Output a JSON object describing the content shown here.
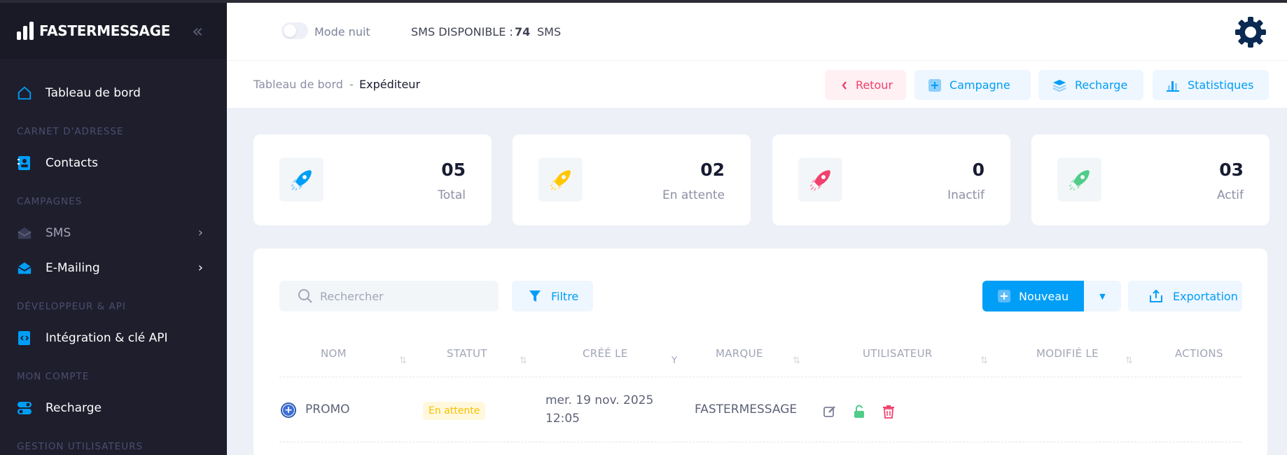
{
  "brand": {
    "name": "FASTERMESSAGE"
  },
  "sidebar": {
    "dashboard": "Tableau de bord",
    "sections": {
      "contacts": "CARNET D'ADRESSE",
      "campaigns": "CAMPAGNES",
      "dev": "DÉVELOPPEUR & API",
      "account": "MON COMPTE",
      "users": "GESTION UTILISATEURS"
    },
    "items": {
      "contacts": "Contacts",
      "sms": "SMS",
      "emailing": "E-Mailing",
      "integration": "Intégration & clé API",
      "recharge": "Recharge"
    }
  },
  "header": {
    "night_mode": "Mode nuit",
    "sms_label": "SMS DISPONIBLE :",
    "sms_count": "74",
    "sms_unit": "SMS"
  },
  "breadcrumb": {
    "root": "Tableau de bord",
    "sep": "-",
    "current": "Expéditeur"
  },
  "toolbar": {
    "back": "Retour",
    "campaign": "Campagne",
    "recharge": "Recharge",
    "stats": "Statistiques"
  },
  "stats": [
    {
      "value": "05",
      "label": "Total",
      "color": "#009ef7"
    },
    {
      "value": "02",
      "label": "En attente",
      "color": "#ffc700"
    },
    {
      "value": "0",
      "label": "Inactif",
      "color": "#f1416c"
    },
    {
      "value": "03",
      "label": "Actif",
      "color": "#50cd89"
    }
  ],
  "table": {
    "search_placeholder": "Rechercher",
    "filter": "Filtre",
    "new": "Nouveau",
    "export": "Exportation",
    "columns": [
      "NOM",
      "STATUT",
      "CRÉÉ LE",
      "MARQUE",
      "UTILISATEUR",
      "MODIFIÉ LE",
      "ACTIONS"
    ],
    "rows": [
      {
        "name": "PROMO",
        "status": "En attente",
        "created_date": "mer. 19 nov. 2025",
        "created_time": "12:05",
        "brand": "FASTERMESSAGE"
      }
    ]
  }
}
